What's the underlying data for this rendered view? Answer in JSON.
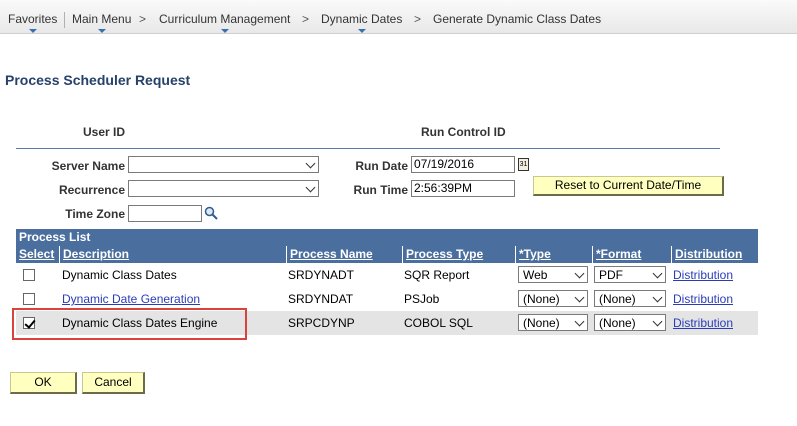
{
  "breadcrumb": {
    "favorites": "Favorites",
    "main_menu": "Main Menu",
    "curriculum": "Curriculum Management",
    "dynamic_dates": "Dynamic Dates",
    "current": "Generate Dynamic Class Dates",
    "separator": ">"
  },
  "page": {
    "title": "Process Scheduler Request"
  },
  "header": {
    "user_id_label": "User ID",
    "run_control_label": "Run Control ID"
  },
  "form": {
    "server_name_label": "Server Name",
    "server_name_value": "",
    "recurrence_label": "Recurrence",
    "recurrence_value": "",
    "time_zone_label": "Time Zone",
    "time_zone_value": "",
    "run_date_label": "Run Date",
    "run_date_value": "07/19/2016",
    "run_time_label": "Run Time",
    "run_time_value": "2:56:39PM",
    "reset_button": "Reset to Current Date/Time",
    "calendar_icon_text": "31"
  },
  "process_list": {
    "title": "Process List",
    "columns": [
      "Select",
      "Description",
      "Process Name",
      "Process Type",
      "*Type",
      "*Format",
      "Distribution"
    ],
    "rows": [
      {
        "selected": false,
        "description": "Dynamic Class Dates",
        "description_is_link": false,
        "process_name": "SRDYNADT",
        "process_type": "SQR Report",
        "type": "Web",
        "format": "PDF",
        "distribution": "Distribution"
      },
      {
        "selected": false,
        "description": "Dynamic Date Generation",
        "description_is_link": true,
        "process_name": "SRDYNDAT",
        "process_type": "PSJob",
        "type": "(None)",
        "format": "(None)",
        "distribution": "Distribution"
      },
      {
        "selected": true,
        "description": "Dynamic Class Dates Engine",
        "description_is_link": false,
        "process_name": "SRPCDYNP",
        "process_type": "COBOL SQL",
        "type": "(None)",
        "format": "(None)",
        "distribution": "Distribution"
      }
    ]
  },
  "actions": {
    "ok": "OK",
    "cancel": "Cancel"
  },
  "colors": {
    "grid_header": "#4a6e9e",
    "title": "#27416a",
    "button": "#ffffc0",
    "highlight": "#d9433c"
  }
}
